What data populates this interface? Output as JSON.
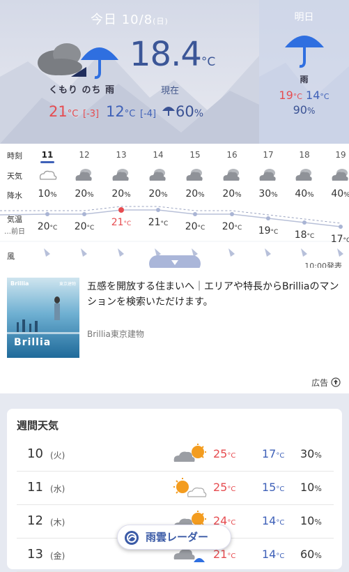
{
  "today": {
    "title": "今日 10/8",
    "dow": "(日)",
    "desc": "くもり のち 雨",
    "current_temp": "18.4",
    "unit": "°C",
    "current_label": "現在",
    "high": "21",
    "high_diff": "[-3]",
    "low": "12",
    "low_diff": "[-4]",
    "rain_pct": "60",
    "pct": "%",
    "icon": "cloud-then-umbrella-icon"
  },
  "tomorrow": {
    "title": "明日",
    "desc": "雨",
    "high": "19",
    "low": "14",
    "rain_pct": "90",
    "icon": "umbrella-icon"
  },
  "hourly": {
    "labels": {
      "time": "時刻",
      "weather": "天気",
      "pop": "降水",
      "temp": "気温",
      "prev": "…前日",
      "wind": "風"
    },
    "hours": [
      "11",
      "12",
      "13",
      "14",
      "15",
      "16",
      "17",
      "18",
      "19"
    ],
    "icons": [
      "cloud-icon",
      "cloudy-icon",
      "cloudy-icon",
      "cloudy-icon",
      "cloudy-icon",
      "cloudy-icon",
      "cloudy-icon",
      "cloudy-icon",
      "cloudy-icon"
    ],
    "pops": [
      "10",
      "20",
      "20",
      "20",
      "20",
      "20",
      "30",
      "40",
      "40"
    ],
    "temps": [
      "20",
      "20",
      "21",
      "21",
      "20",
      "20",
      "19",
      "18",
      "17"
    ],
    "issued": "10:00発表"
  },
  "ad": {
    "text": "五感を開放する住まいへ｜エリアや特長からBrilliaのマンションを検索いただけます。",
    "sponsor": "Brillia東京建物",
    "label": "広告",
    "img_brand": "Brillia",
    "img_corp": "東京建物",
    "img_logo": "Brillia"
  },
  "weekly": {
    "title": "週間天気",
    "days": [
      {
        "day": "10",
        "dow": "(火)",
        "hi": "25",
        "lo": "17",
        "pop": "30",
        "icon": "cloud-sun-icon"
      },
      {
        "day": "11",
        "dow": "(水)",
        "hi": "25",
        "lo": "15",
        "pop": "10",
        "icon": "sun-cloud-icon"
      },
      {
        "day": "12",
        "dow": "(木)",
        "hi": "24",
        "lo": "14",
        "pop": "10",
        "icon": "cloud-sun-icon"
      },
      {
        "day": "13",
        "dow": "(金)",
        "hi": "21",
        "lo": "14",
        "pop": "60",
        "icon": "cloud-rain-icon"
      }
    ]
  },
  "radar": {
    "label": "雨雲レーダー",
    "icon": "radar-icon"
  },
  "colors": {
    "high": "#e64c50",
    "low": "#3f61b8",
    "accent": "#3a5294"
  }
}
